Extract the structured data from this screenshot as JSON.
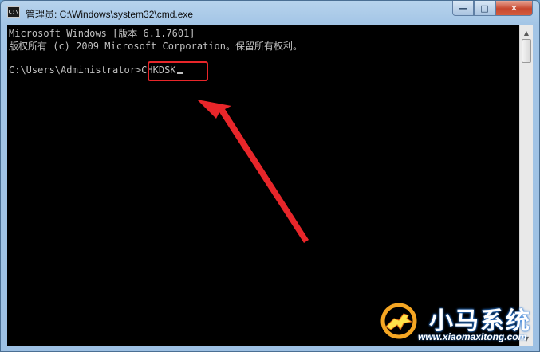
{
  "window": {
    "title": "管理员: C:\\Windows\\system32\\cmd.exe",
    "app_icon_text": "C:\\",
    "buttons": {
      "minimize": "—",
      "maximize": "□",
      "close": "✕"
    }
  },
  "console": {
    "lines": [
      "Microsoft Windows [版本 6.1.7601]",
      "版权所有 (c) 2009 Microsoft Corporation。保留所有权利。",
      ""
    ],
    "prompt": "C:\\Users\\Administrator>",
    "command": "CHKDSK"
  },
  "annotation": {
    "highlight_color": "#e8262a",
    "arrow_color": "#e8262a"
  },
  "watermark": {
    "brand": "小马系统",
    "url": "www.xiaomaxitong.com"
  },
  "scrollbar": {
    "up": "▲",
    "down": "▼"
  }
}
